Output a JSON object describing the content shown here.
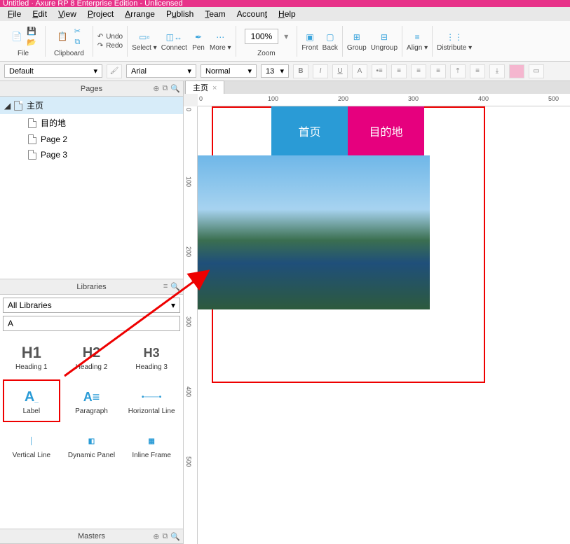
{
  "window_title": "Untitled · Axure RP 8 Enterprise Edition - Unlicensed",
  "menu": [
    "File",
    "Edit",
    "View",
    "Project",
    "Arrange",
    "Publish",
    "Team",
    "Account",
    "Help"
  ],
  "toolbar": {
    "file": "File",
    "clipboard": "Clipboard",
    "undo": "Undo",
    "redo": "Redo",
    "select": "Select",
    "connect": "Connect",
    "pen": "Pen",
    "more": "More",
    "zoom_value": "100%",
    "zoom": "Zoom",
    "front": "Front",
    "back": "Back",
    "group": "Group",
    "ungroup": "Ungroup",
    "align": "Align",
    "distribute": "Distribute"
  },
  "format": {
    "style": "Default",
    "font": "Arial",
    "weight": "Normal",
    "size": "13"
  },
  "panels": {
    "pages": "Pages",
    "libraries": "Libraries",
    "masters": "Masters"
  },
  "pages": [
    {
      "label": "主页",
      "selected": true,
      "expanded": true,
      "children": [
        {
          "label": "目的地"
        },
        {
          "label": "Page 2"
        },
        {
          "label": "Page 3"
        }
      ]
    }
  ],
  "libraries": {
    "selector": "All Libraries",
    "search": "A",
    "items": [
      {
        "label": "Heading 1",
        "glyph": "H1"
      },
      {
        "label": "Heading 2",
        "glyph": "H2"
      },
      {
        "label": "Heading 3",
        "glyph": "H3"
      },
      {
        "label": "Label",
        "glyph": "A_"
      },
      {
        "label": "Paragraph",
        "glyph": "A≡"
      },
      {
        "label": "Horizontal Line",
        "glyph": "─"
      },
      {
        "label": "Vertical Line",
        "glyph": "│"
      },
      {
        "label": "Dynamic Panel",
        "glyph": "◧"
      },
      {
        "label": "Inline Frame",
        "glyph": "▦"
      }
    ]
  },
  "canvas": {
    "tab": "主页",
    "nav1": "首页",
    "nav2": "目的地",
    "ruler_ticks_h": [
      "0",
      "100",
      "200",
      "300",
      "400",
      "500"
    ],
    "ruler_ticks_v": [
      "0",
      "100",
      "200",
      "300",
      "400",
      "500"
    ]
  }
}
